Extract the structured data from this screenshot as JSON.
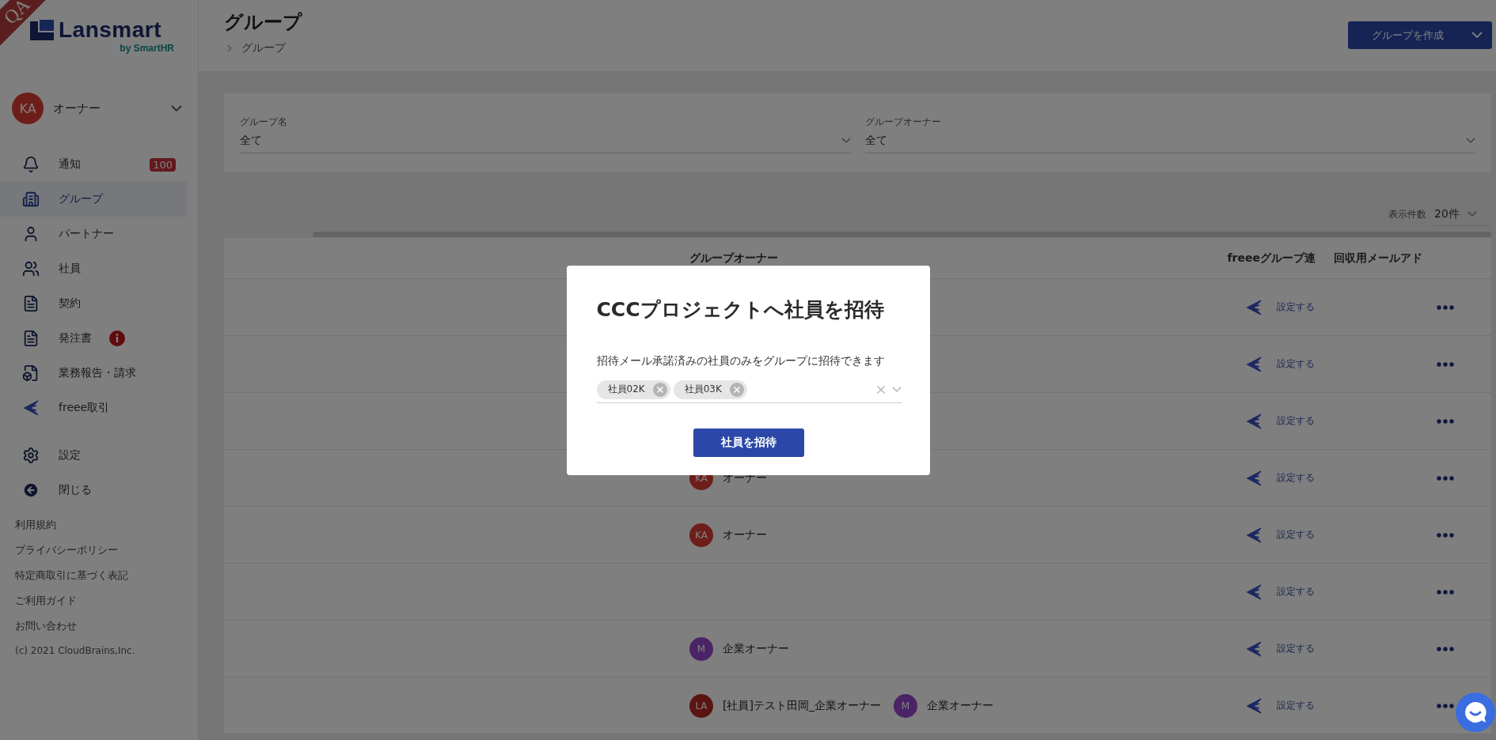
{
  "ribbon": "QA",
  "logo": {
    "name": "Lansmart",
    "byline": "by SmartHR"
  },
  "user": {
    "initials": "KA",
    "name": "オーナー",
    "color": "#6e1e18"
  },
  "nav": [
    {
      "label": "通知",
      "badge": "100",
      "alert": false,
      "selected": false
    },
    {
      "label": "グループ",
      "alert": false,
      "selected": true
    },
    {
      "label": "パートナー",
      "alert": false,
      "selected": false
    },
    {
      "label": "社員",
      "alert": false,
      "selected": false
    },
    {
      "label": "契約",
      "alert": false,
      "selected": false
    },
    {
      "label": "発注書",
      "alert": true,
      "selected": false
    },
    {
      "label": "業務報告・請求",
      "alert": false,
      "selected": false
    },
    {
      "label": "freee取引",
      "alert": false,
      "selected": false
    }
  ],
  "nav_bottom": [
    {
      "label": "設定"
    },
    {
      "label": "閉じる"
    }
  ],
  "footer_links": [
    "利用規約",
    "プライバシーポリシー",
    "特定商取引に基づく表記",
    "ご利用ガイド",
    "お問い合わせ"
  ],
  "copyright": "(c) 2021 CloudBrains,Inc.",
  "header": {
    "title": "グループ",
    "breadcrumb": [
      "グループ"
    ],
    "create_button": "グループを作成"
  },
  "filters": [
    {
      "label": "グループ名",
      "value": "全て"
    },
    {
      "label": "グループオーナー",
      "value": "全て"
    }
  ],
  "page_size": {
    "label": "表示件数",
    "value": "20件"
  },
  "table": {
    "columns": [
      "グループオーナー",
      "freeeグループ連",
      "回収用メールアド"
    ],
    "rows": [
      {
        "owners": [],
        "freee": "設定する"
      },
      {
        "owners": [],
        "freee": "設定する"
      },
      {
        "owners": [],
        "freee": "設定する"
      },
      {
        "owners": [
          {
            "initials": "KA",
            "name": "オーナー",
            "color": "#6e1e18"
          }
        ],
        "freee": "設定する"
      },
      {
        "owners": [
          {
            "initials": "KA",
            "name": "オーナー",
            "color": "#6e1e18"
          }
        ],
        "freee": "設定する"
      },
      {
        "owners": [],
        "freee": "設定する"
      },
      {
        "owners": [
          {
            "initials": "M",
            "name": "企業オーナー",
            "color": "#4a2466"
          }
        ],
        "freee": "設定する"
      },
      {
        "owners": [
          {
            "initials": "LA",
            "name": "[社員]テスト田岡_企業オーナー",
            "color": "#5a1512"
          },
          {
            "initials": "M",
            "name": "企業オーナー",
            "color": "#4a2466"
          }
        ],
        "freee": "設定する"
      }
    ]
  },
  "modal": {
    "title": "CCCプロジェクトへ社員を招待",
    "description": "招待メール承諾済みの社員のみをグループに招待できます",
    "chips": [
      "社員02K",
      "社員03K"
    ],
    "button": "社員を招待"
  }
}
